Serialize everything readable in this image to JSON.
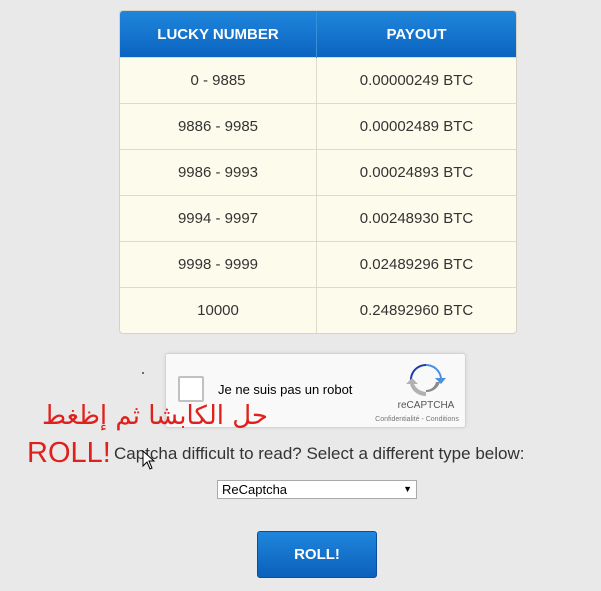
{
  "table": {
    "headers": [
      "LUCKY NUMBER",
      "PAYOUT"
    ],
    "rows": [
      {
        "range": "0 - 9885",
        "payout": "0.00000249 BTC"
      },
      {
        "range": "9886 - 9985",
        "payout": "0.00002489 BTC"
      },
      {
        "range": "9986 - 9993",
        "payout": "0.00024893 BTC"
      },
      {
        "range": "9994 - 9997",
        "payout": "0.00248930 BTC"
      },
      {
        "range": "9998 - 9999",
        "payout": "0.02489296 BTC"
      },
      {
        "range": "10000",
        "payout": "0.24892960 BTC"
      }
    ]
  },
  "recaptcha": {
    "label": "Je ne suis pas un robot",
    "brand": "reCAPTCHA",
    "terms": "Confidentialité - Conditions"
  },
  "annotation": {
    "arabic": "حل الكابشا ثم إظغط",
    "roll": "ROLL!"
  },
  "captcha_help": "Captcha difficult to read? Select a different type below:",
  "captcha_select": {
    "value": "ReCaptcha",
    "icon": "chevron-down-icon"
  },
  "roll_button": "ROLL!",
  "colors": {
    "accent": "#0b64c0",
    "annotation": "#e0201c",
    "table_bg": "#fdfcec"
  }
}
